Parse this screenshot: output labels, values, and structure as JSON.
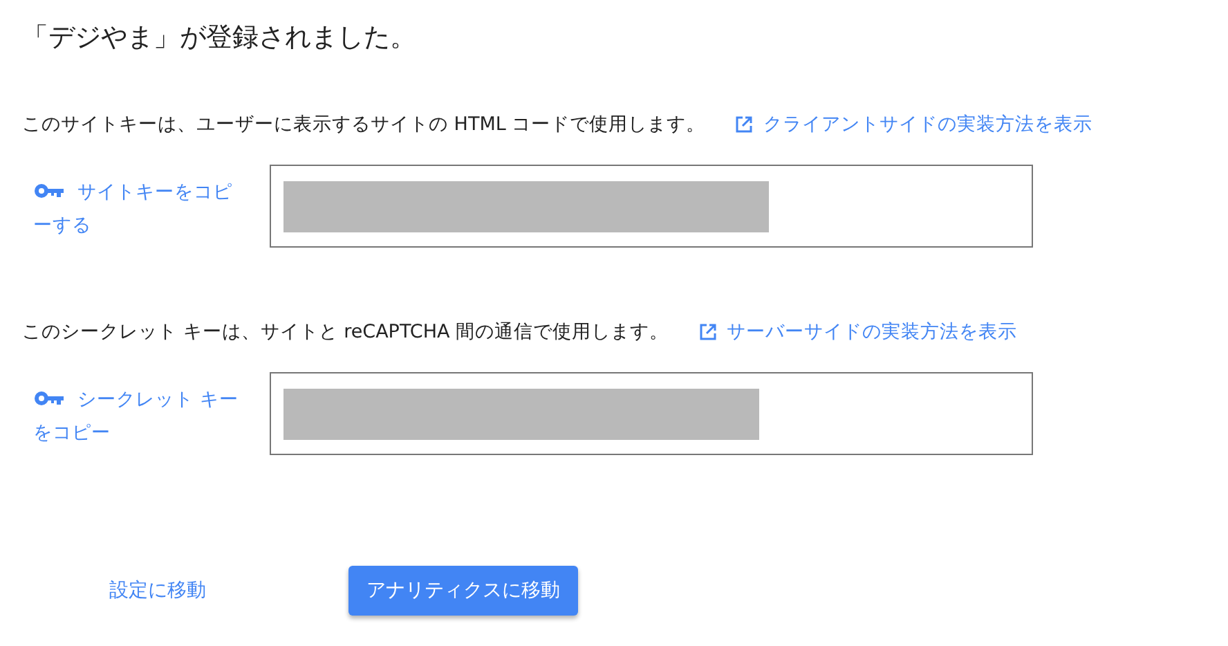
{
  "title": "「デジやま」が登録されました。",
  "sections": [
    {
      "description": "このサイトキーは、ユーザーに表示するサイトの HTML コードで使用します。",
      "doc_link": "クライアントサイドの実装方法を表示",
      "copy_link": "サイトキーをコピーする"
    },
    {
      "description": "このシークレット キーは、サイトと reCAPTCHA 間の通信で使用します。",
      "doc_link": "サーバーサイドの実装方法を表示",
      "copy_link": "シークレット キーをコピー"
    }
  ],
  "buttons": [
    {
      "label": "設定に移動",
      "kind": "text"
    },
    {
      "label": "アナリティクスに移動",
      "kind": "raised"
    }
  ]
}
